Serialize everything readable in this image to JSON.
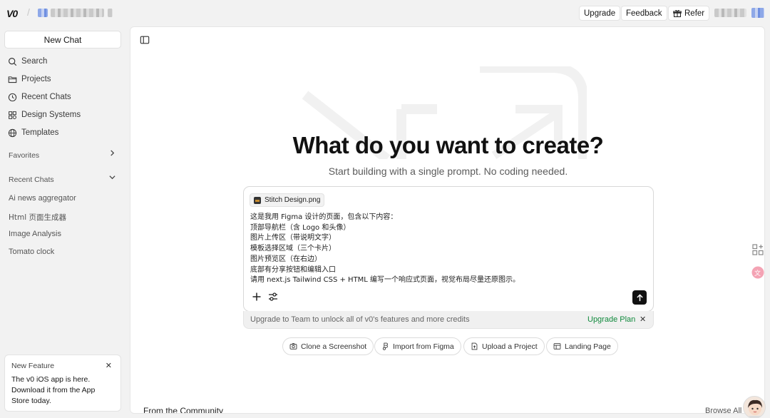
{
  "header": {
    "logo": "V0",
    "upgrade": "Upgrade",
    "feedback": "Feedback",
    "refer": "Refer"
  },
  "sidebar": {
    "new_chat": "New Chat",
    "nav": [
      {
        "label": "Search",
        "icon": "search-icon"
      },
      {
        "label": "Projects",
        "icon": "folder-icon"
      },
      {
        "label": "Recent Chats",
        "icon": "clock-icon"
      },
      {
        "label": "Design Systems",
        "icon": "grid-icon"
      },
      {
        "label": "Templates",
        "icon": "globe-icon"
      }
    ],
    "favorites": "Favorites",
    "recent_section": "Recent Chats",
    "recent_items": [
      "Ai news aggregator",
      "Html 页面生成器",
      "Image Analysis",
      "Tomato clock"
    ],
    "feature": {
      "title": "New Feature",
      "body_1": "The v0 iOS app is here.",
      "body_2": "Download it from the App",
      "body_3": "Store today."
    }
  },
  "main": {
    "title": "What do you want to create?",
    "subtitle": "Start building with a single prompt. No coding needed.",
    "attachment": "Stitch Design.png",
    "prompt_lines": [
      "这是我用 Figma 设计的页面，包含以下内容：",
      "顶部导航栏（含 Logo 和头像）",
      "图片上传区（带说明文字）",
      "模板选择区域（三个卡片）",
      "图片预览区（在右边）",
      "底部有分享按钮和编辑入口",
      "请用 next.js Tailwind CSS + HTML 编写一个响应式页面，视觉布局尽量还原图示。"
    ],
    "upgrade_text": "Upgrade to Team to unlock all of v0's features and more credits",
    "upgrade_link": "Upgrade Plan",
    "chips": [
      {
        "label": "Clone a Screenshot",
        "icon": "camera-icon"
      },
      {
        "label": "Import from Figma",
        "icon": "figma-icon"
      },
      {
        "label": "Upload a Project",
        "icon": "file-upload-icon"
      },
      {
        "label": "Landing Page",
        "icon": "layout-icon"
      }
    ],
    "community": "From the Community",
    "browse_all": "Browse All"
  },
  "colors": {
    "accent_green": "#118a3d",
    "send_button": "#111111",
    "app_background": "#f2f2f2"
  }
}
